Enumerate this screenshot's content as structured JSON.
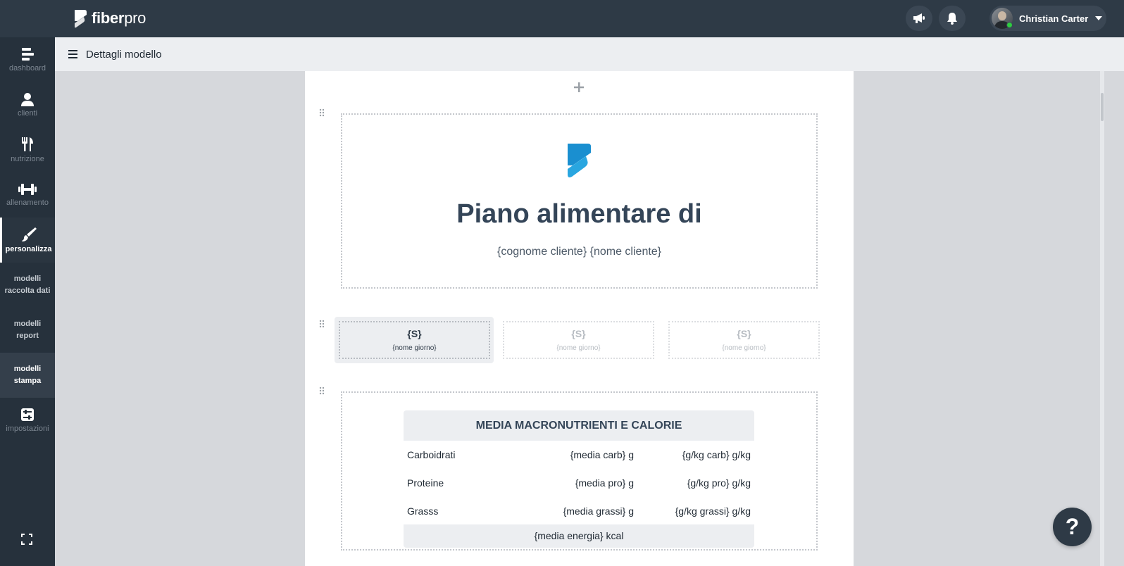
{
  "app": {
    "brand_bold": "fiber",
    "brand_light": "pro",
    "user_name": "Christian Carter"
  },
  "sidebar": {
    "items": [
      {
        "label": "dashboard",
        "icon": "dashboard-icon"
      },
      {
        "label": "clienti",
        "icon": "user-icon"
      },
      {
        "label": "nutrizione",
        "icon": "utensils-icon"
      },
      {
        "label": "allenamento",
        "icon": "dumbbell-icon"
      },
      {
        "label": "personalizza",
        "icon": "brush-icon"
      },
      {
        "label": "modelli raccolta dati"
      },
      {
        "label": "modelli report"
      },
      {
        "label": "modelli stampa"
      },
      {
        "label": "impostazioni",
        "icon": "sliders-icon"
      }
    ]
  },
  "header": {
    "title": "Dettagli modello"
  },
  "document": {
    "title": "Piano alimentare di",
    "subtitle": "{cognome cliente} {nome cliente}",
    "day_cards": [
      {
        "symbol": "{S}",
        "name": "{nome giorno}",
        "active": true
      },
      {
        "symbol": "{S}",
        "name": "{nome giorno}",
        "active": false
      },
      {
        "symbol": "{S}",
        "name": "{nome giorno}",
        "active": false
      }
    ],
    "macro_table": {
      "heading": "MEDIA MACRONUTRIENTI E CALORIE",
      "rows": [
        {
          "name": "Carboidrati",
          "avg": "{media carb} g",
          "per_kg": "{g/kg carb} g/kg"
        },
        {
          "name": "Proteine",
          "avg": "{media pro} g",
          "per_kg": "{g/kg pro} g/kg"
        },
        {
          "name": "Grasss",
          "avg": "{media grassi} g",
          "per_kg": "{g/kg grassi} g/kg"
        }
      ],
      "footer": "{media energia} kcal"
    }
  },
  "help": {
    "label": "?"
  },
  "colors": {
    "topbar": "#2e3a46",
    "sidebar": "#26313c",
    "brand_blue": "#1a8fd0",
    "title": "#344558"
  }
}
